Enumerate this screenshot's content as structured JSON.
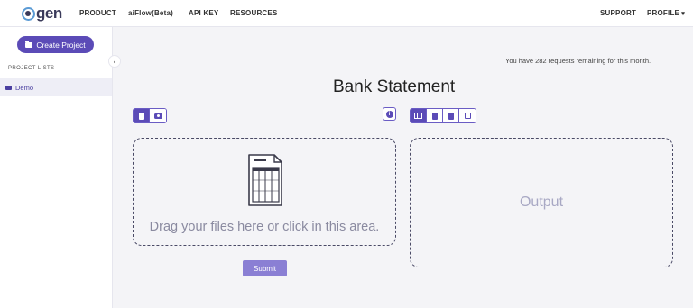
{
  "brand": {
    "logo_text": "gen"
  },
  "nav": {
    "items": [
      "PRODUCT",
      "aiFlow(Beta)",
      "API KEY",
      "RESOURCES"
    ],
    "support": "SUPPORT",
    "profile": "PROFILE"
  },
  "sidebar": {
    "create_project": "Create Project",
    "section_label": "PROJECT LISTS",
    "projects": [
      {
        "label": "Demo",
        "active": true
      }
    ]
  },
  "main": {
    "requests_notice": "You have 282 requests remaining for this month.",
    "title": "Bank Statement",
    "input_modes": [
      "document-icon",
      "camera-icon"
    ],
    "output_modes": [
      "table-icon",
      "document-icon",
      "document-icon",
      "square-icon"
    ],
    "dropzone_text": "Drag your files here or click in this area.",
    "output_placeholder": "Output",
    "submit": "Submit"
  },
  "colors": {
    "accent": "#5b4bb7",
    "submit": "#8a7fd4",
    "placeholder": "#a8a8c4"
  }
}
